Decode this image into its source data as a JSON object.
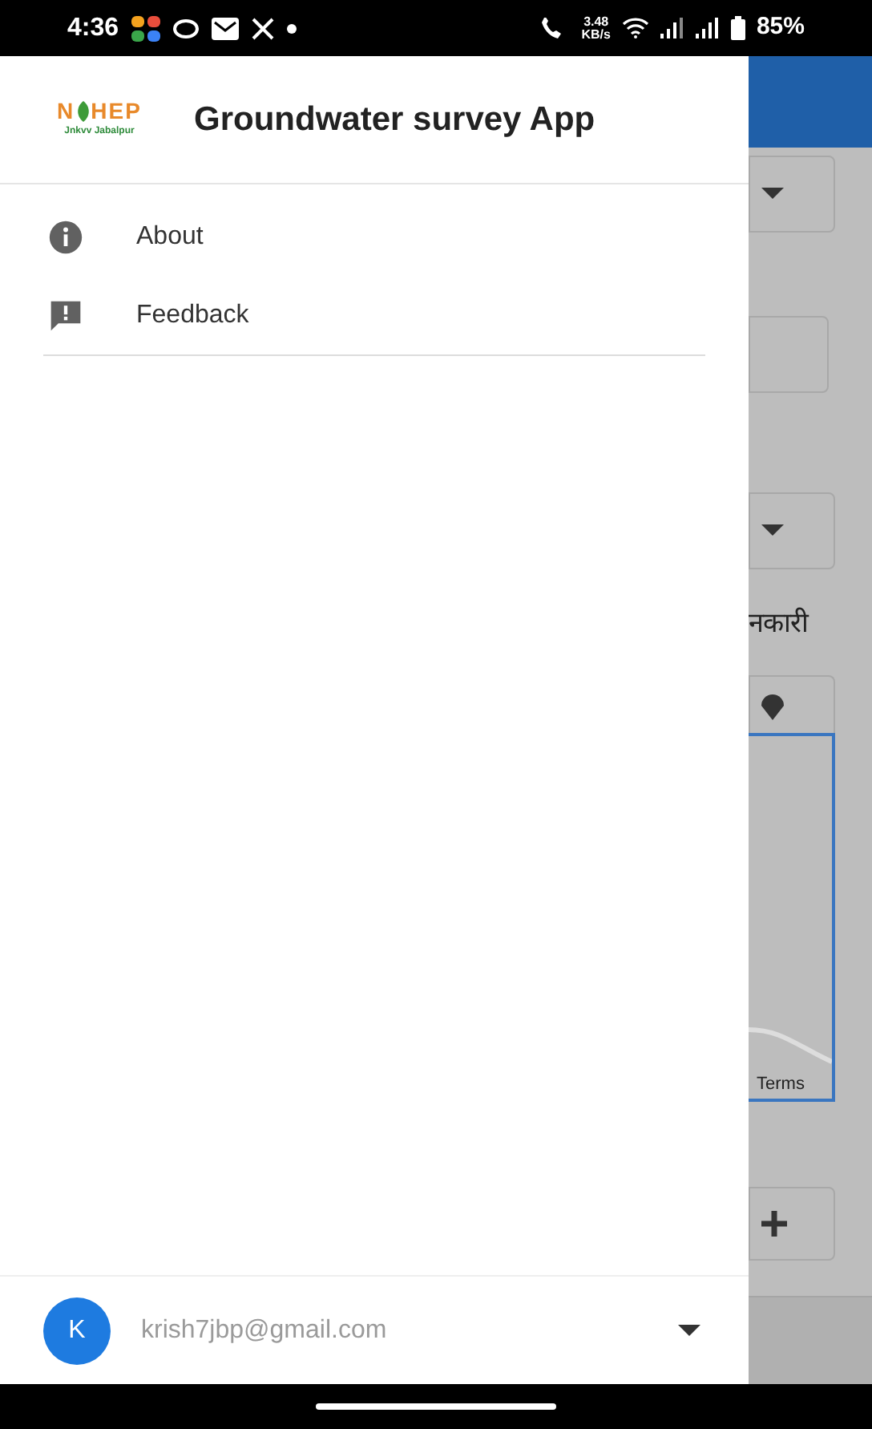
{
  "status_bar": {
    "time": "4:36",
    "speed_value": "3.48",
    "speed_unit": "KB/s",
    "battery": "85%"
  },
  "drawer": {
    "logo": {
      "left": "N",
      "right": "HEP",
      "subtitle": "Jnkvv Jabalpur"
    },
    "title": "Groundwater survey App",
    "items": [
      {
        "kind": "info",
        "label": "About"
      },
      {
        "kind": "feedback",
        "label": "Feedback"
      }
    ],
    "account": {
      "initial": "K",
      "email": "krish7jbp@gmail.com"
    }
  },
  "background": {
    "partial_label": "नकारी",
    "map_terms": "Terms"
  }
}
